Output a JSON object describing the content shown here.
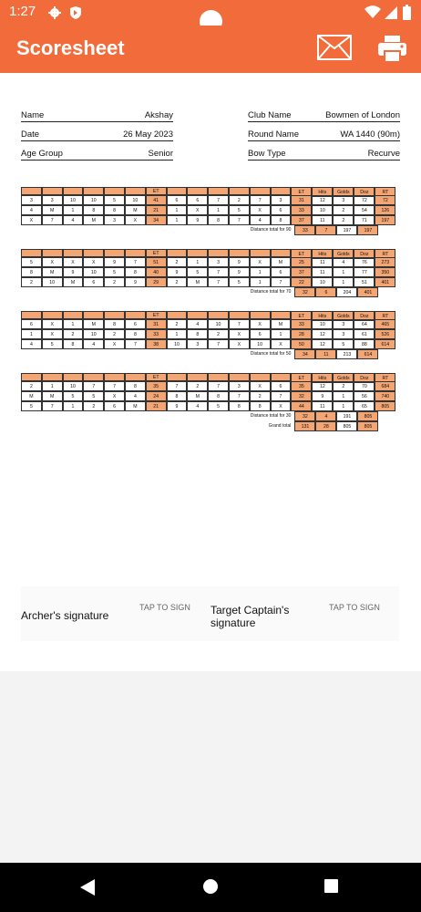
{
  "status": {
    "time": "1:27"
  },
  "appbar": {
    "title": "Scoresheet",
    "mail_icon": "mail-icon",
    "print_icon": "print-icon"
  },
  "info": {
    "name_label": "Name",
    "name": "Akshay",
    "date_label": "Date",
    "date": "26 May 2023",
    "age_label": "Age Group",
    "age": "Senior",
    "club_label": "Club Name",
    "club": "Bowmen of London",
    "round_label": "Round Name",
    "round": "WA 1440 (90m)",
    "bow_label": "Bow Type",
    "bow": "Recurve"
  },
  "sum_headers": [
    "ET",
    "Hits",
    "Golds",
    "Doz",
    "RT"
  ],
  "et_label": "ET",
  "distances": [
    {
      "ends": [
        {
          "a": [
            "3",
            "3",
            "10",
            "10",
            "5",
            "10"
          ],
          "a_et": "41",
          "b": [
            "6",
            "6",
            "7",
            "2",
            "7",
            "3"
          ],
          "b_et": "31",
          "hits": "12",
          "golds": "3",
          "doz": "72",
          "rt": "72"
        },
        {
          "a": [
            "4",
            "M",
            "1",
            "8",
            "8",
            "M"
          ],
          "a_et": "21",
          "b": [
            "1",
            "X",
            "1",
            "5",
            "X",
            "6"
          ],
          "b_et": "33",
          "hits": "10",
          "golds": "2",
          "doz": "54",
          "rt": "126"
        },
        {
          "a": [
            "X",
            "7",
            "4",
            "M",
            "3",
            "X"
          ],
          "a_et": "34",
          "b": [
            "1",
            "9",
            "8",
            "7",
            "4",
            "8"
          ],
          "b_et": "37",
          "hits": "11",
          "golds": "2",
          "doz": "71",
          "rt": "197"
        }
      ],
      "total_label": "Distance total for 90",
      "total": [
        "33",
        "7",
        "197",
        "197"
      ]
    },
    {
      "ends": [
        {
          "a": [
            "5",
            "X",
            "X",
            "X",
            "9",
            "7"
          ],
          "a_et": "51",
          "b": [
            "2",
            "1",
            "3",
            "9",
            "X",
            "M"
          ],
          "b_et": "25",
          "hits": "11",
          "golds": "4",
          "doz": "76",
          "rt": "273"
        },
        {
          "a": [
            "8",
            "M",
            "9",
            "10",
            "5",
            "8"
          ],
          "a_et": "40",
          "b": [
            "9",
            "5",
            "7",
            "9",
            "1",
            "6"
          ],
          "b_et": "37",
          "hits": "11",
          "golds": "1",
          "doz": "77",
          "rt": "350"
        },
        {
          "a": [
            "2",
            "10",
            "M",
            "6",
            "2",
            "9"
          ],
          "a_et": "29",
          "b": [
            "2",
            "M",
            "7",
            "5",
            "1",
            "7"
          ],
          "b_et": "22",
          "hits": "10",
          "golds": "1",
          "doz": "51",
          "rt": "401"
        }
      ],
      "total_label": "Distance total for 70",
      "total": [
        "32",
        "6",
        "204",
        "401"
      ]
    },
    {
      "ends": [
        {
          "a": [
            "6",
            "X",
            "1",
            "M",
            "8",
            "6"
          ],
          "a_et": "31",
          "b": [
            "2",
            "4",
            "10",
            "7",
            "X",
            "M"
          ],
          "b_et": "33",
          "hits": "10",
          "golds": "3",
          "doz": "64",
          "rt": "465"
        },
        {
          "a": [
            "1",
            "X",
            "2",
            "10",
            "2",
            "8"
          ],
          "a_et": "33",
          "b": [
            "1",
            "8",
            "2",
            "X",
            "6",
            "1"
          ],
          "b_et": "28",
          "hits": "12",
          "golds": "3",
          "doz": "61",
          "rt": "526"
        },
        {
          "a": [
            "4",
            "5",
            "8",
            "4",
            "X",
            "7"
          ],
          "a_et": "38",
          "b": [
            "10",
            "3",
            "7",
            "X",
            "10",
            "X"
          ],
          "b_et": "50",
          "hits": "12",
          "golds": "5",
          "doz": "88",
          "rt": "614"
        }
      ],
      "total_label": "Distance total for 50",
      "total": [
        "34",
        "11",
        "213",
        "614"
      ]
    },
    {
      "ends": [
        {
          "a": [
            "2",
            "1",
            "10",
            "7",
            "7",
            "8"
          ],
          "a_et": "35",
          "b": [
            "7",
            "2",
            "7",
            "3",
            "X",
            "6"
          ],
          "b_et": "35",
          "hits": "12",
          "golds": "2",
          "doz": "70",
          "rt": "684"
        },
        {
          "a": [
            "M",
            "M",
            "5",
            "5",
            "X",
            "4"
          ],
          "a_et": "24",
          "b": [
            "8",
            "M",
            "8",
            "7",
            "2",
            "7"
          ],
          "b_et": "32",
          "hits": "9",
          "golds": "1",
          "doz": "56",
          "rt": "740"
        },
        {
          "a": [
            "5",
            "7",
            "1",
            "2",
            "6",
            "M"
          ],
          "a_et": "21",
          "b": [
            "9",
            "4",
            "5",
            "8",
            "8",
            "X"
          ],
          "b_et": "44",
          "hits": "11",
          "golds": "1",
          "doz": "65",
          "rt": "805"
        }
      ],
      "total_label": "Distance total for 30",
      "total": [
        "32",
        "4",
        "191",
        "805"
      ]
    }
  ],
  "grand_total_label": "Grand total",
  "grand_total": [
    "131",
    "28",
    "805",
    "805"
  ],
  "signatures": {
    "archer_label": "Archer's signature",
    "archer_tap": "TAP TO SIGN",
    "captain_label": "Target Captain's signature",
    "captain_tap": "TAP TO SIGN"
  }
}
